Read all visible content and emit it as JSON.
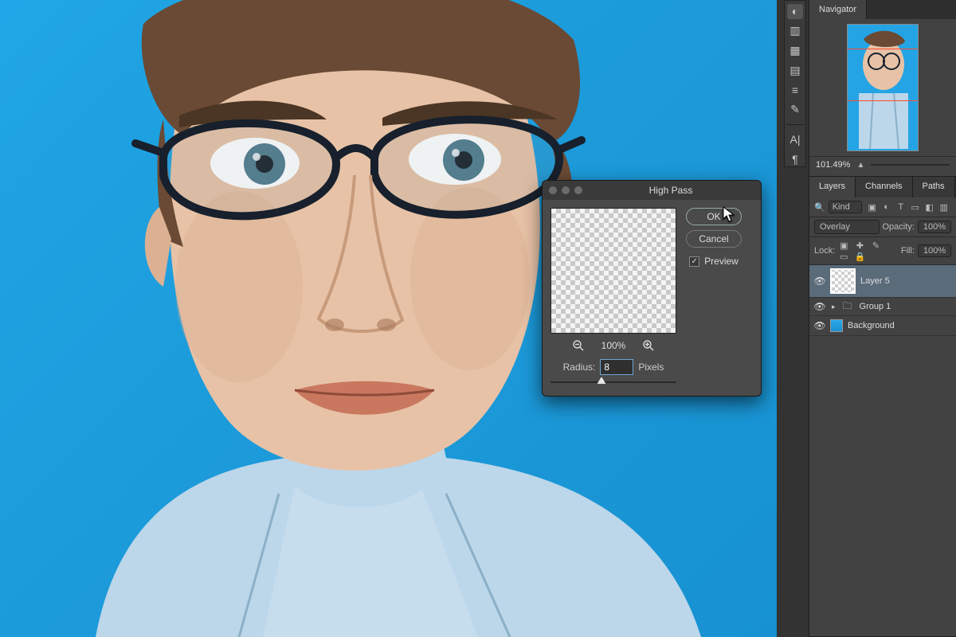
{
  "vtoolbar": {
    "items": [
      {
        "name": "adjustments-icon",
        "glyph": "◐"
      },
      {
        "name": "histogram-icon",
        "glyph": "▥"
      },
      {
        "name": "swatches-icon",
        "glyph": "▦"
      },
      {
        "name": "styles-icon",
        "glyph": "▤"
      },
      {
        "name": "properties-icon",
        "glyph": "≡"
      },
      {
        "name": "brush-icon",
        "glyph": "✎"
      }
    ],
    "items2": [
      {
        "name": "character-icon",
        "glyph": "A|"
      },
      {
        "name": "paragraph-icon",
        "glyph": "¶"
      }
    ]
  },
  "navigator": {
    "tab_label": "Navigator",
    "zoom": "101.49%"
  },
  "layers_panel": {
    "tabs": [
      "Layers",
      "Channels",
      "Paths"
    ],
    "active_tab": 0,
    "kind_label": "Kind",
    "filter_icons": [
      {
        "n": "image-filter",
        "g": "▣"
      },
      {
        "n": "adjust-filter",
        "g": "◐"
      },
      {
        "n": "type-filter",
        "g": "T"
      },
      {
        "n": "shape-filter",
        "g": "▭"
      },
      {
        "n": "smart-filter",
        "g": "◧"
      },
      {
        "n": "clip-filter",
        "g": "▥"
      }
    ],
    "blend_mode": "Overlay",
    "opacity_label": "Opacity:",
    "opacity_value": "100%",
    "lock_label": "Lock:",
    "fill_label": "Fill:",
    "fill_value": "100%",
    "layers": [
      {
        "name": "Layer 5",
        "type": "pixel",
        "selected": true
      },
      {
        "name": "Group 1",
        "type": "group",
        "selected": false
      },
      {
        "name": "Background",
        "type": "bg",
        "selected": false
      }
    ]
  },
  "dialog": {
    "title": "High Pass",
    "ok": "OK",
    "cancel": "Cancel",
    "preview_label": "Preview",
    "preview_checked": true,
    "zoom_value": "100%",
    "radius_label": "Radius:",
    "radius_value": "8",
    "radius_unit": "Pixels"
  }
}
